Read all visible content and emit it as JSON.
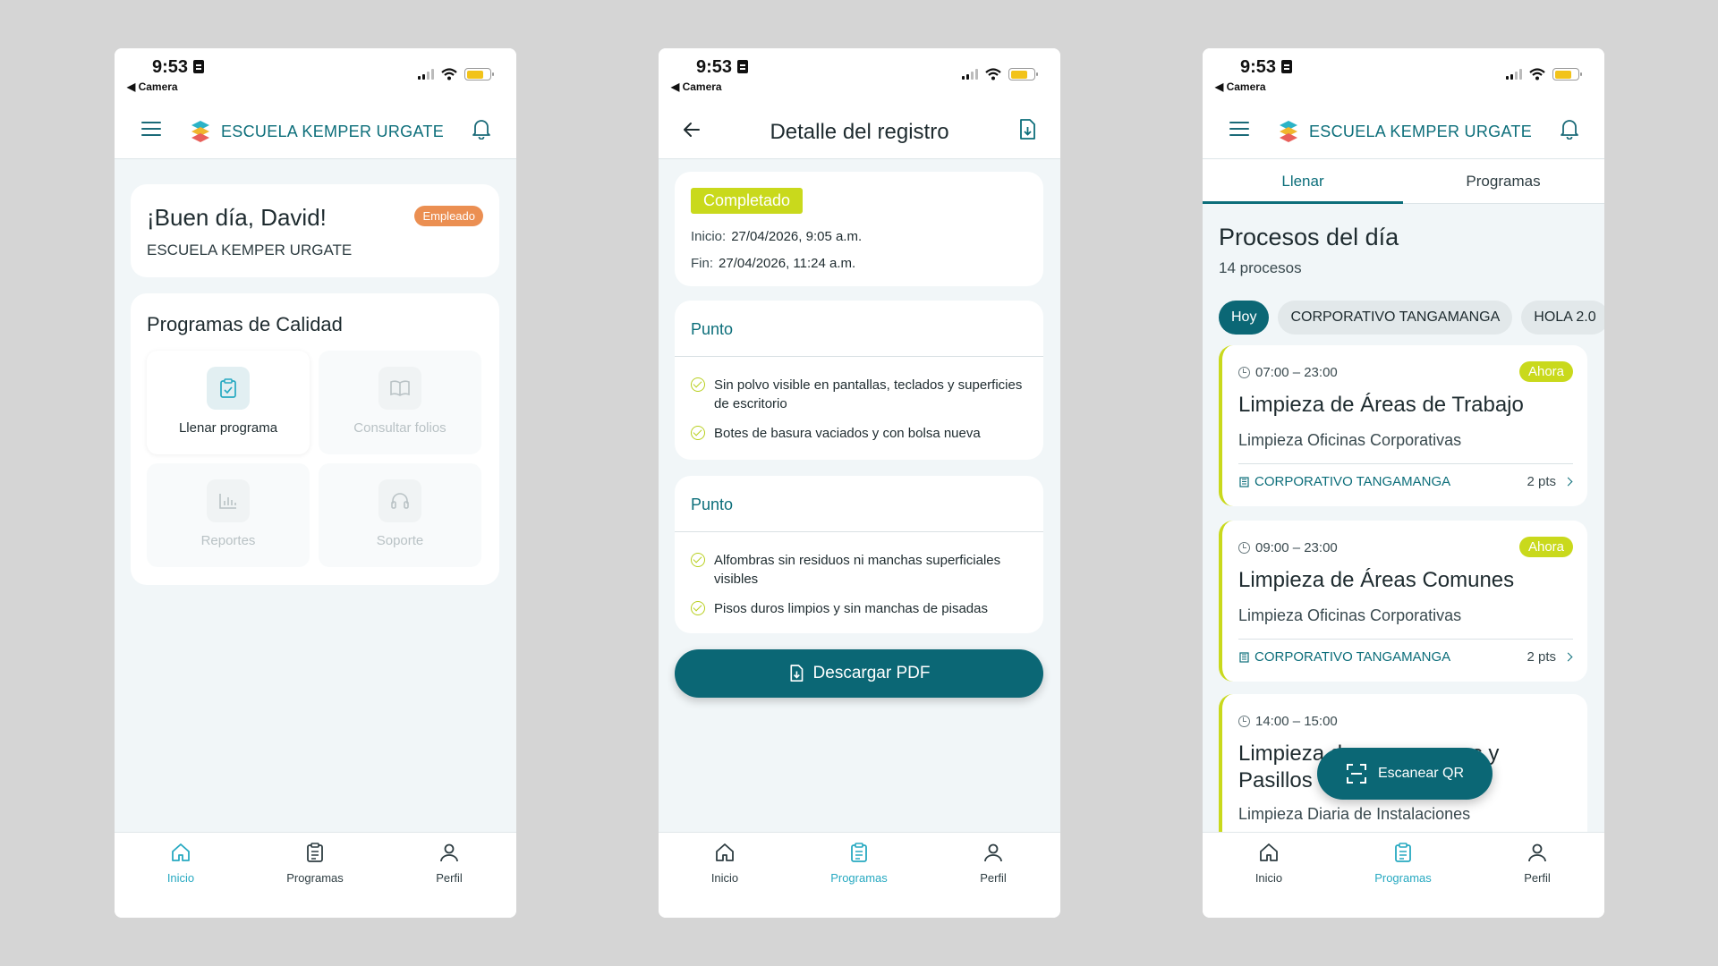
{
  "status_bar": {
    "time": "9:53",
    "back_app": "Camera"
  },
  "brand": {
    "name": "ESCUELA KEMPER URGATE"
  },
  "screen_home": {
    "greeting": "¡Buen día, David!",
    "role_badge": "Empleado",
    "school": "ESCUELA KEMPER URGATE",
    "section_title": "Programas de Calidad",
    "tiles": [
      {
        "label": "Llenar programa",
        "icon": "clipboard-check-icon",
        "enabled": true
      },
      {
        "label": "Consultar folios",
        "icon": "book-open-icon",
        "enabled": false
      },
      {
        "label": "Reportes",
        "icon": "bar-chart-icon",
        "enabled": false
      },
      {
        "label": "Soporte",
        "icon": "headset-icon",
        "enabled": false
      }
    ]
  },
  "screen_detail": {
    "title": "Detalle del registro",
    "status": "Completado",
    "start_label": "Inicio:",
    "start_value": "27/04/2026, 9:05 a.m.",
    "end_label": "Fin:",
    "end_value": "27/04/2026, 11:24 a.m.",
    "puntos": [
      {
        "title": "Punto",
        "items": [
          "Sin polvo visible en pantallas, teclados y superficies de escritorio",
          "Botes de basura vaciados y con bolsa nueva"
        ]
      },
      {
        "title": "Punto",
        "items": [
          "Alfombras sin residuos ni manchas superficiales visibles",
          "Pisos duros limpios y sin manchas de pisadas"
        ]
      }
    ],
    "download_button": "Descargar PDF"
  },
  "screen_processes": {
    "tabs": [
      "Llenar",
      "Programas"
    ],
    "active_tab": "Llenar",
    "title": "Procesos del día",
    "count": "14 procesos",
    "chips": [
      "Hoy",
      "CORPORATIVO TANGAMANGA",
      "HOLA 2.0"
    ],
    "processes": [
      {
        "time": "07:00 – 23:00",
        "badge": "Ahora",
        "name": "Limpieza de Áreas de Trabajo",
        "category": "Limpieza Oficinas Corporativas",
        "location": "CORPORATIVO TANGAMANGA",
        "points": "2 pts"
      },
      {
        "time": "09:00 – 23:00",
        "badge": "Ahora",
        "name": "Limpieza de Áreas Comunes",
        "category": "Limpieza Oficinas Corporativas",
        "location": "CORPORATIVO TANGAMANGA",
        "points": "2 pts"
      },
      {
        "time": "14:00 – 15:00",
        "name_visible": "Limpieza d",
        "name_suffix": "nes y",
        "name_line2": "Pasillos",
        "category": "Limpieza Diaria de Instalaciones"
      }
    ],
    "scan_button": "Escanear QR"
  },
  "nav": {
    "inicio": "Inicio",
    "programas": "Programas",
    "perfil": "Perfil"
  },
  "colors": {
    "brand_teal": "#0b6775",
    "active_nav": "#27a9c1",
    "accent_lime": "#c9d91c",
    "badge_orange": "#eb8f52"
  }
}
